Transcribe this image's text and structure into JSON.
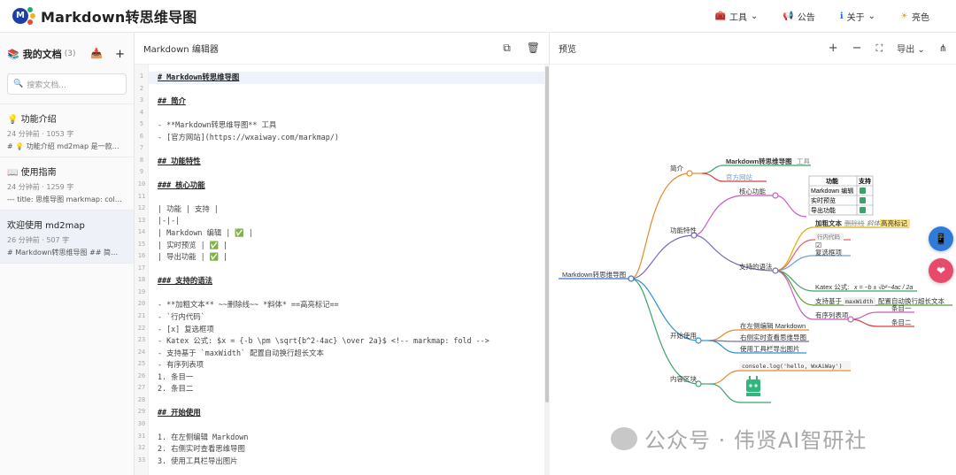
{
  "app": {
    "title": "Markdown转思维导图"
  },
  "header": {
    "tools": "工具",
    "notice": "公告",
    "about": "关于",
    "theme": "亮色"
  },
  "sidebar": {
    "title": "我的文档",
    "count": "(3)",
    "search_placeholder": "搜索文档...",
    "docs": [
      {
        "title": "💡 功能介绍",
        "meta": "24 分钟前 · 1053 字",
        "snippet": "# 💡 功能介绍 md2map 是一款功能强..."
      },
      {
        "title": "📖 使用指南",
        "meta": "24 分钟前 · 1259 字",
        "snippet": "--- title: 思维导图 markmap: colorFr..."
      },
      {
        "title": "欢迎使用 md2map",
        "meta": "26 分钟前 · 507 字",
        "snippet": "# Markdown转思维导图 ## 简介 - **..."
      }
    ]
  },
  "editor": {
    "title": "Markdown 编辑器",
    "lines": [
      "# Markdown转思维导图",
      "",
      "## 简介",
      "",
      "- **Markdown转思维导图** 工具",
      "- [官方网站](https://wxaiway.com/markmap/)",
      "",
      "## 功能特性",
      "",
      "### 核心功能",
      "",
      "| 功能 | 支持 |",
      "|-|-|",
      "| Markdown 编辑 | ✅ |",
      "| 实时预览 | ✅ |",
      "| 导出功能 | ✅ |",
      "",
      "### 支持的语法",
      "",
      "- **加粗文本** ~~删除线~~ *斜体* ==高亮标记==",
      "- `行内代码`",
      "- [x] 复选框项",
      "- Katex 公式: $x = {-b \\pm \\sqrt{b^2-4ac} \\over 2a}$ <!-- markmap: fold -->",
      "- 支持基于 `maxWidth` 配置自动换行超长文本",
      "- 有序列表项",
      "  1. 条目一",
      "  2. 条目二",
      "",
      "## 开始使用",
      "",
      "1. 在左侧编辑 Markdown",
      "2. 右侧实时查看思维导图",
      "3. 使用工具栏导出图片"
    ]
  },
  "preview": {
    "title": "预览",
    "export": "导出"
  },
  "mindmap": {
    "root": "Markdown转思维导图",
    "branches": {
      "intro": "简介",
      "features": "功能特性",
      "start": "开始使用",
      "content": "内容区块"
    },
    "intro_items": [
      "Markdown转思维导图",
      "工具",
      "官方网站"
    ],
    "core": "核心功能",
    "table_head": [
      "功能",
      "支持"
    ],
    "table_rows": [
      "Markdown 编辑",
      "实时预览",
      "导出功能"
    ],
    "syntax": "支持的语法",
    "syntax_items": {
      "bold": "加粗文本",
      "strike": "删除线",
      "italic": "斜体",
      "highlight": "高亮标记",
      "code": "行内代码",
      "checkbox": "复选框项",
      "katex_prefix": "Katex 公式:",
      "katex_formula": "x = −b ± √b²−4ac / 2a",
      "maxwidth_a": "支持基于",
      "maxwidth_code": "maxWidth",
      "maxwidth_b": "配置自动换行超长文本",
      "ordered": "有序列表项",
      "item1": "条目一",
      "item2": "条目二"
    },
    "start_items": [
      "在左侧编辑 Markdown",
      "右侧实时查看思维导图",
      "使用工具栏导出图片"
    ],
    "content_code": "console.log('hello, WxAiWay')"
  },
  "watermark": "公众号 · 伟贤AI智研社",
  "colors": {
    "accent": "#1f3fa8",
    "branch_intro": "#e8892c",
    "branch_features": "#7a6bb0",
    "branch_start": "#2b8fd9",
    "branch_content": "#3aa36a",
    "highlight": "#fbe28a"
  }
}
